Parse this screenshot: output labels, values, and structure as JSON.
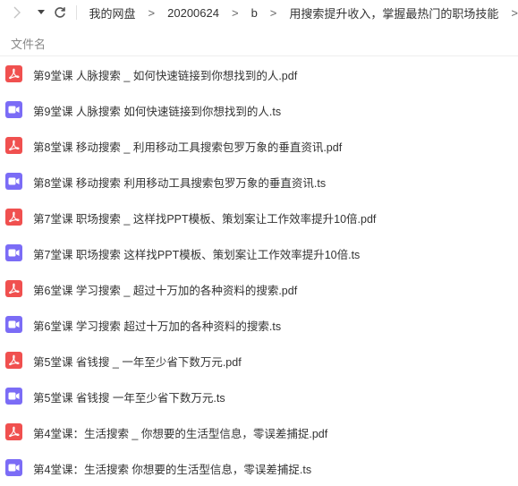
{
  "toolbar": {
    "forward_icon": "chevron-right-icon",
    "dropdown_icon": "caret-down-icon",
    "refresh_icon": "refresh-icon",
    "breadcrumb": [
      "我的网盘",
      "20200624",
      "b",
      "用搜索提升收入，掌握最热门的职场技能"
    ],
    "separator": ">"
  },
  "list_header": {
    "name_label": "文件名"
  },
  "colors": {
    "pdf": "#f0504f",
    "ts": "#7b6cf6"
  },
  "files": [
    {
      "name": "第9堂课 人脉搜索 _ 如何快速链接到你想找到的人.pdf",
      "type": "pdf"
    },
    {
      "name": "第9堂课 人脉搜索  如何快速链接到你想找到的人.ts",
      "type": "ts"
    },
    {
      "name": "第8堂课 移动搜索 _ 利用移动工具搜索包罗万象的垂直资讯.pdf",
      "type": "pdf"
    },
    {
      "name": "第8堂课 移动搜索  利用移动工具搜索包罗万象的垂直资讯.ts",
      "type": "ts"
    },
    {
      "name": "第7堂课 职场搜索 _ 这样找PPT模板、策划案让工作效率提升10倍.pdf",
      "type": "pdf"
    },
    {
      "name": "第7堂课 职场搜索  这样找PPT模板、策划案让工作效率提升10倍.ts",
      "type": "ts"
    },
    {
      "name": "第6堂课 学习搜索 _ 超过十万加的各种资料的搜索.pdf",
      "type": "pdf"
    },
    {
      "name": "第6堂课 学习搜索  超过十万加的各种资料的搜索.ts",
      "type": "ts"
    },
    {
      "name": "第5堂课 省钱搜 _ 一年至少省下数万元.pdf",
      "type": "pdf"
    },
    {
      "name": "第5堂课 省钱搜  一年至少省下数万元.ts",
      "type": "ts"
    },
    {
      "name": "第4堂课：生活搜索 _ 你想要的生活型信息，零误差捕捉.pdf",
      "type": "pdf"
    },
    {
      "name": "第4堂课：生活搜索  你想要的生活型信息，零误差捕捉.ts",
      "type": "ts"
    }
  ]
}
